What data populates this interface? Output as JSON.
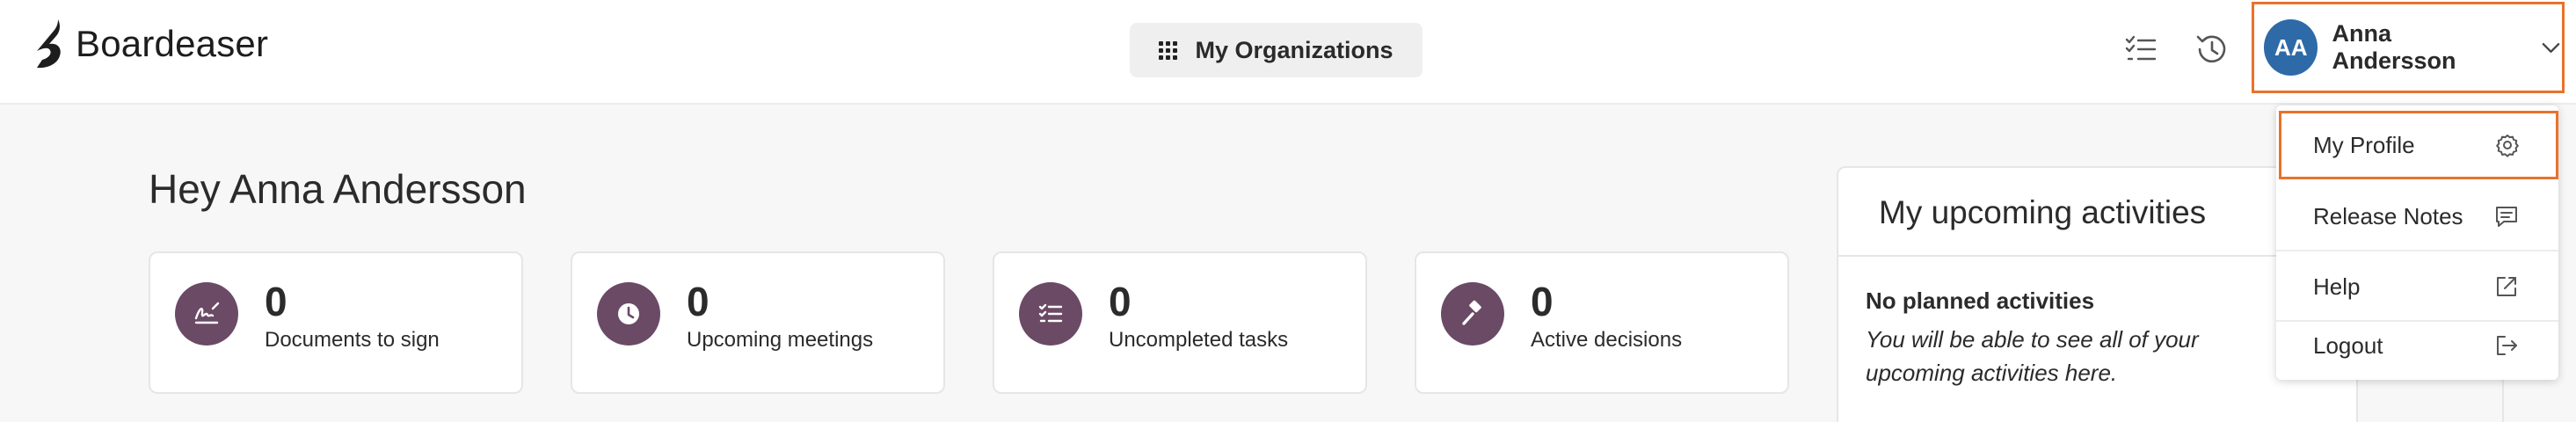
{
  "header": {
    "logo_text": "Boardeaser",
    "org_button_label": "My Organizations",
    "user": {
      "initials": "AA",
      "name": "Anna Andersson"
    },
    "colors": {
      "highlight": "#e8722c",
      "avatar": "#2e6aa7"
    }
  },
  "main": {
    "greeting": "Hey Anna Andersson",
    "cards": [
      {
        "count": "0",
        "label": "Documents to sign",
        "icon": "signature-icon"
      },
      {
        "count": "0",
        "label": "Upcoming meetings",
        "icon": "clock-icon"
      },
      {
        "count": "0",
        "label": "Uncompleted tasks",
        "icon": "checklist-icon"
      },
      {
        "count": "0",
        "label": "Active decisions",
        "icon": "gavel-icon"
      }
    ],
    "card_color": "#6b4a66"
  },
  "activities": {
    "title": "My upcoming activities",
    "empty_title": "No planned activities",
    "empty_desc": "You will be able to see all of your upcoming activities here."
  },
  "user_menu": {
    "items": [
      {
        "label": "My Profile",
        "icon": "gear-icon"
      },
      {
        "label": "Release Notes",
        "icon": "message-icon"
      },
      {
        "label": "Help",
        "icon": "external-link-icon"
      },
      {
        "label": "Logout",
        "icon": "logout-icon"
      }
    ]
  }
}
